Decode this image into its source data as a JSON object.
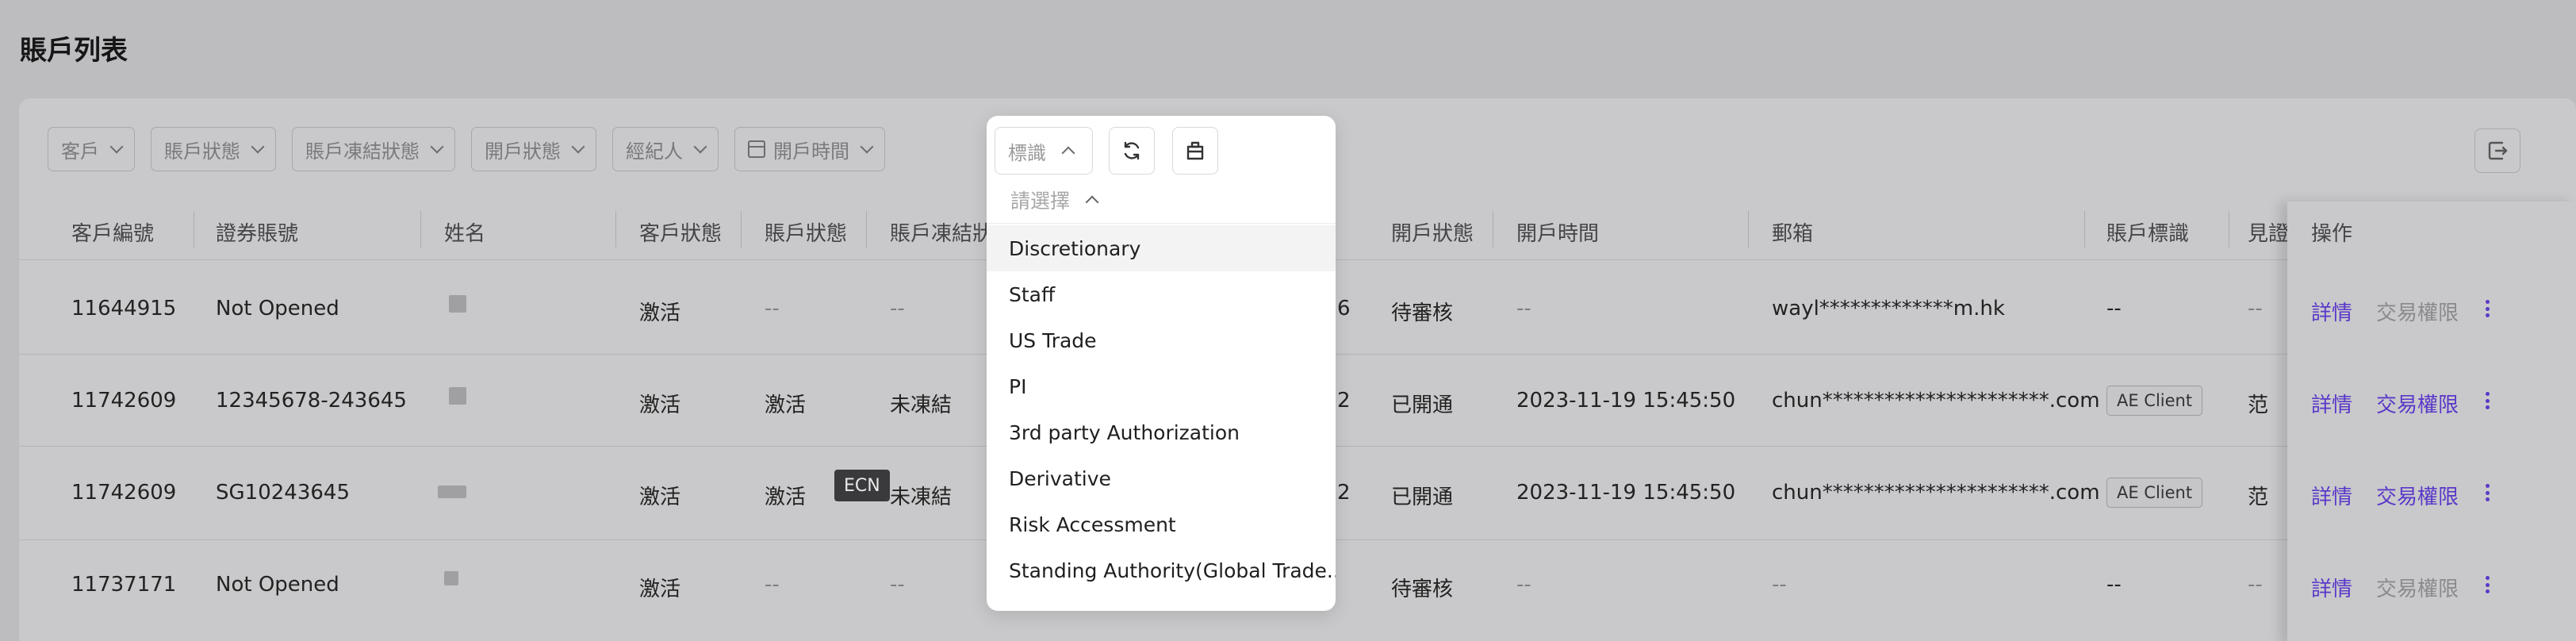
{
  "page": {
    "title": "賬戶列表"
  },
  "filters": [
    {
      "label": "客戶",
      "icon": "chevron-down-icon"
    },
    {
      "label": "賬戶狀態",
      "icon": "chevron-down-icon"
    },
    {
      "label": "賬戶凍結狀態",
      "icon": "chevron-down-icon"
    },
    {
      "label": "開戶狀態",
      "icon": "chevron-down-icon"
    },
    {
      "label": "經紀人",
      "icon": "chevron-down-icon"
    },
    {
      "label": "開戶時間",
      "icon": "calendar-icon"
    }
  ],
  "popup": {
    "tag_select_placeholder": "標識",
    "refresh_icon": "refresh-icon",
    "clear_icon": "clear-icon",
    "dropdown_placeholder": "請選擇",
    "options": [
      "Discretionary",
      "Staff",
      "US Trade",
      "PI",
      "3rd party Authorization",
      "Derivative",
      "Risk Accessment",
      "Standing Authority(Global Trade..."
    ]
  },
  "table": {
    "headers": {
      "client_no": "客戶編號",
      "securities_account": "證券賬號",
      "name": "姓名",
      "client_status": "客戶狀態",
      "account_status": "賬戶狀態",
      "freeze_status": "賬戶凍結狀",
      "opening_status": "開戶狀態",
      "opening_time": "開戶時間",
      "email": "郵箱",
      "account_tag": "賬戶標識",
      "witness": "見證",
      "actions": "操作"
    },
    "rows": [
      {
        "client_no": "11644915",
        "securities_account": "Not Opened",
        "client_status": "激活",
        "account_status": "--",
        "freeze_status": "--",
        "partial": "6",
        "opening_status": "待審核",
        "opening_time": "--",
        "email": "wayl*************m.hk",
        "account_tag": "--",
        "witness": "--",
        "detail": "詳情",
        "trade_permission": "交易權限",
        "trade_permission_enabled": false
      },
      {
        "client_no": "11742609",
        "securities_account": "12345678-243645",
        "client_status": "激活",
        "account_status": "激活",
        "freeze_status": "未凍結",
        "partial": "2",
        "opening_status": "已開通",
        "opening_time": "2023-11-19 15:45:50",
        "email": "chun**********************.com",
        "account_tag": "AE Client",
        "witness": "范",
        "detail": "詳情",
        "trade_permission": "交易權限",
        "trade_permission_enabled": true
      },
      {
        "client_no": "11742609",
        "securities_account": "SG10243645",
        "client_status": "激活",
        "account_status": "激活",
        "freeze_status": "未凍結",
        "partial": "2",
        "opening_status": "已開通",
        "opening_time": "2023-11-19 15:45:50",
        "email": "chun**********************.com",
        "account_tag": "AE Client",
        "witness": "范",
        "detail": "詳情",
        "trade_permission": "交易權限",
        "trade_permission_enabled": true
      },
      {
        "client_no": "11737171",
        "securities_account": "Not Opened",
        "client_status": "激活",
        "account_status": "--",
        "freeze_status": "--",
        "partial": "",
        "opening_status": "待審核",
        "opening_time": "--",
        "email": "--",
        "account_tag": "--",
        "witness": "--",
        "detail": "詳情",
        "trade_permission": "交易權限",
        "trade_permission_enabled": false
      }
    ]
  },
  "tooltip": "ECN",
  "colors": {
    "link": "#5a38c9",
    "overlay": "#bdbdc0",
    "popup_bg": "#ffffff"
  }
}
